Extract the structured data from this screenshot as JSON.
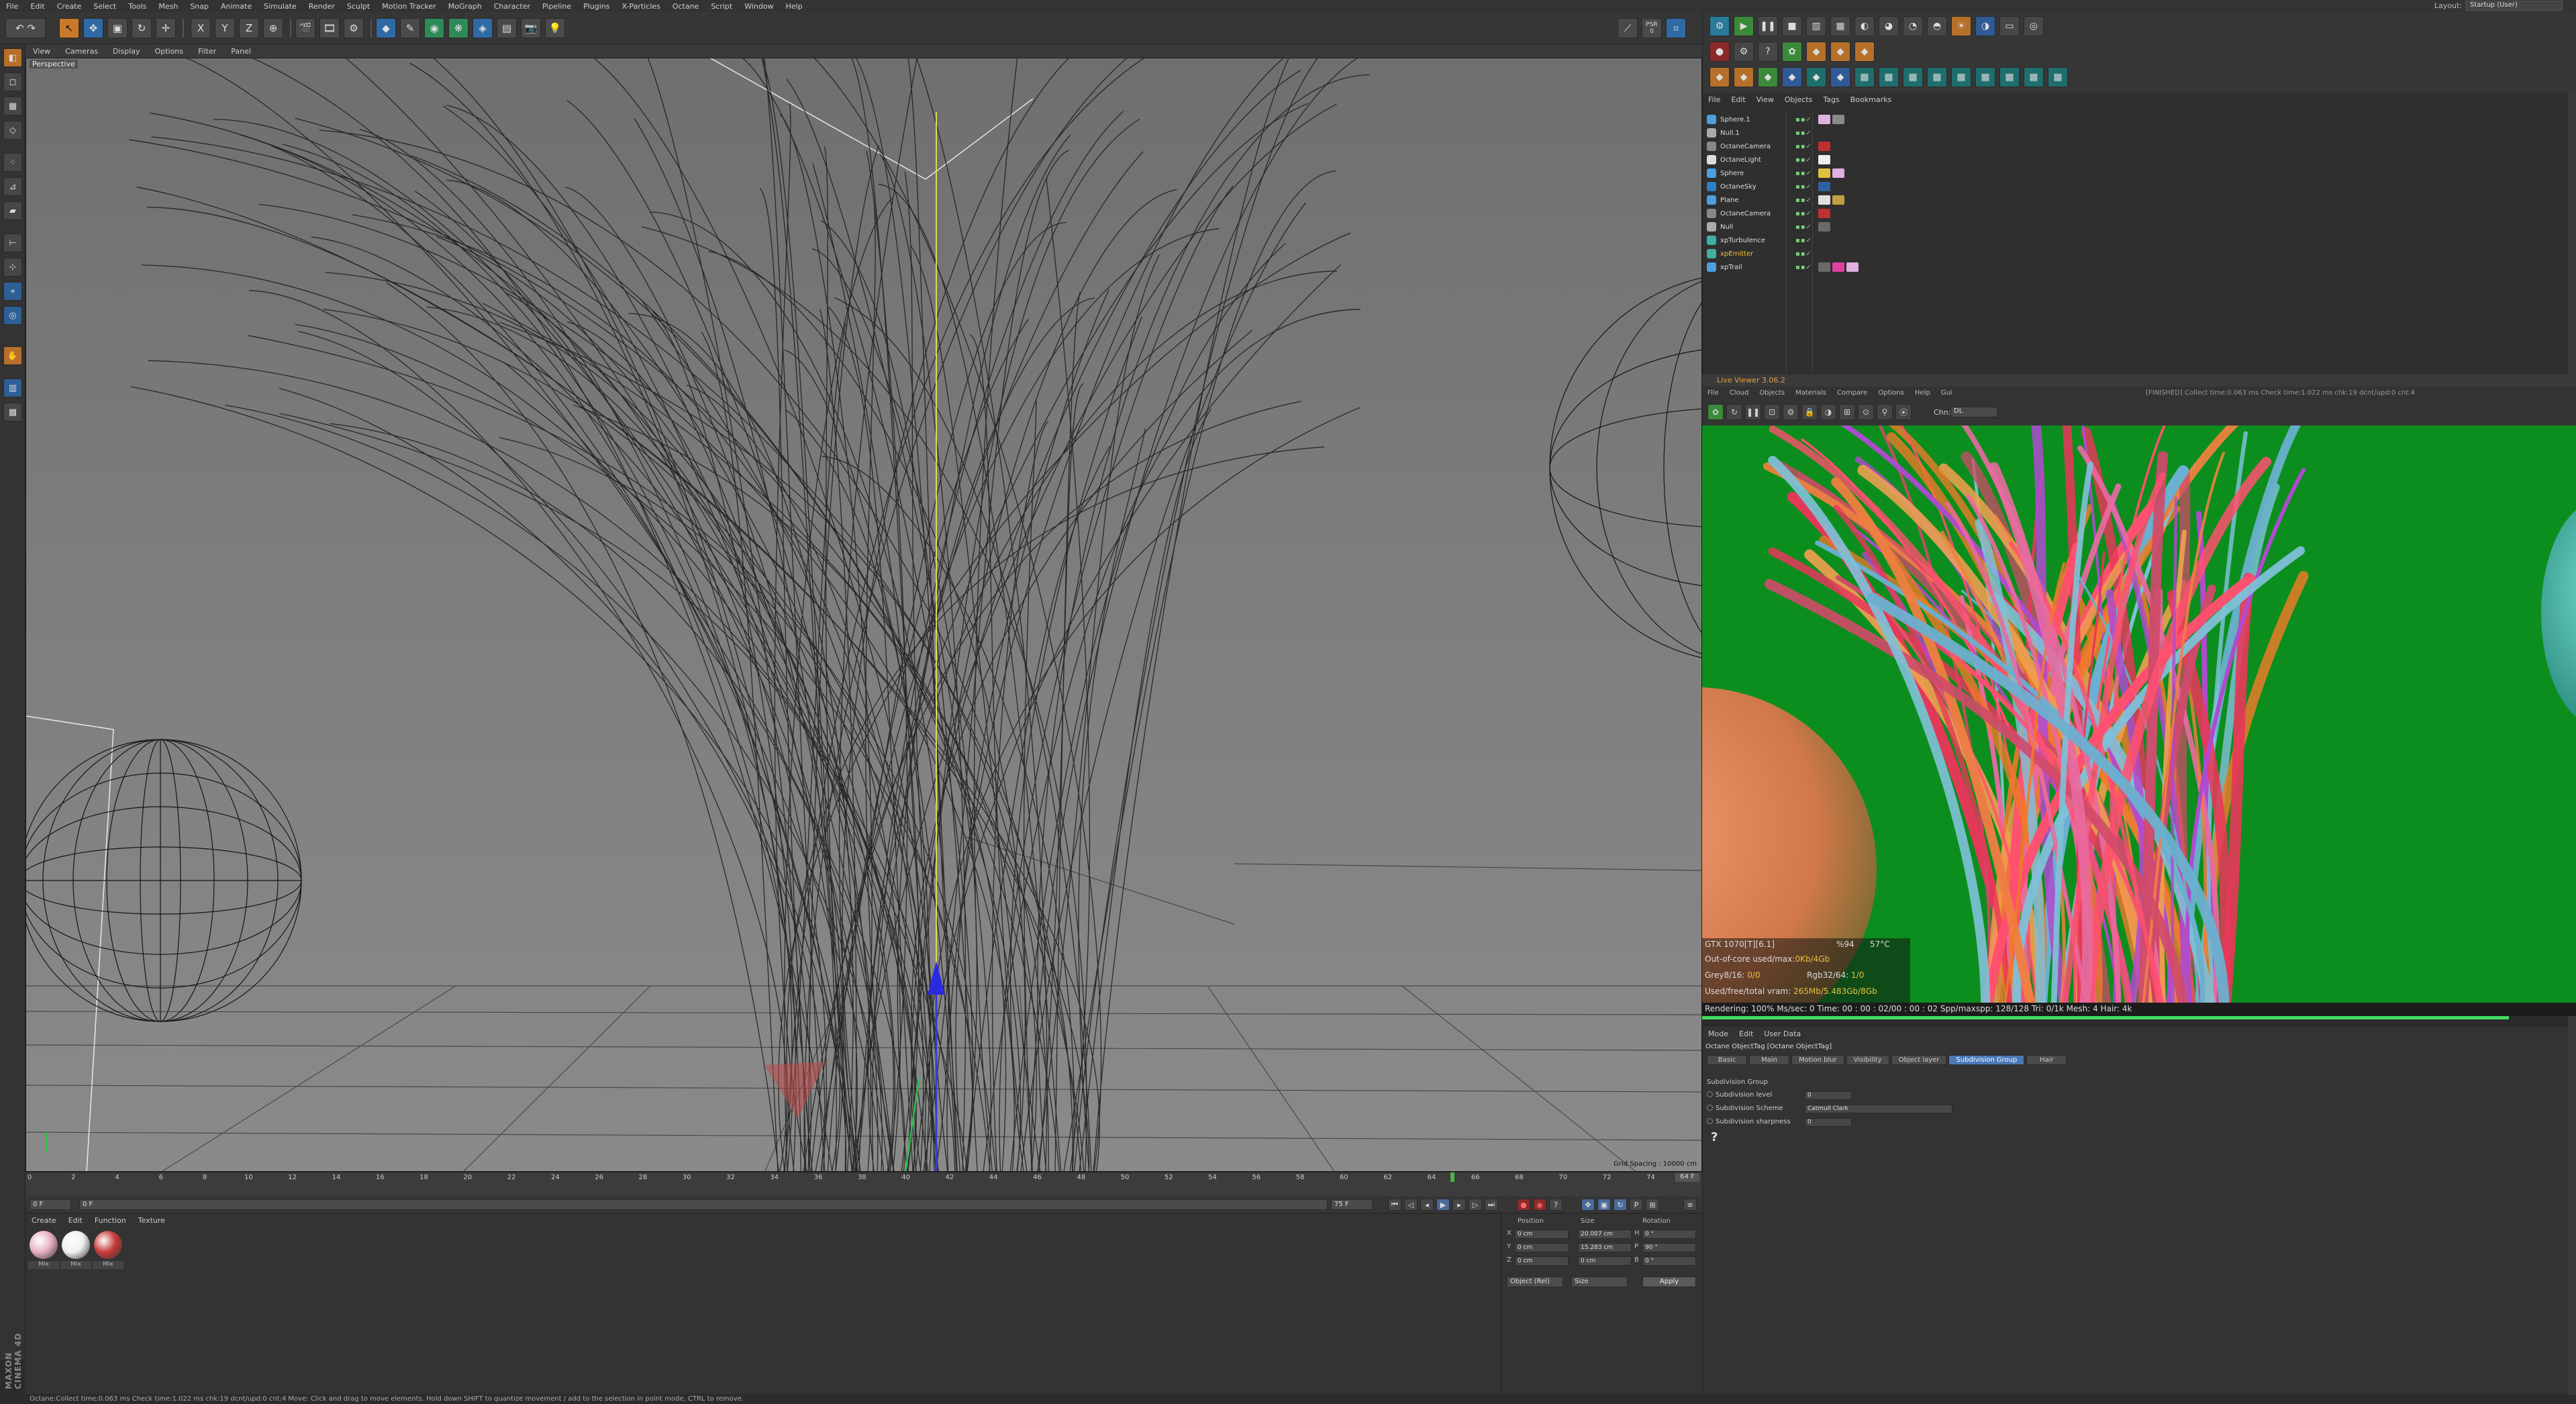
{
  "menubar": {
    "items": [
      "File",
      "Edit",
      "Create",
      "Select",
      "Tools",
      "Mesh",
      "Snap",
      "Animate",
      "Simulate",
      "Render",
      "Sculpt",
      "Motion Tracker",
      "MoGraph",
      "Character",
      "Pipeline",
      "Plugins",
      "X-Particles",
      "Octane",
      "Script",
      "Window",
      "Help"
    ],
    "layout_label": "Layout:",
    "layout_value": "Startup (User)"
  },
  "toolbar": {
    "psr_label": "PSR",
    "psr_value": "0",
    "axis_x": "X",
    "axis_y": "Y",
    "axis_z": "Z"
  },
  "viewport": {
    "menu": [
      "View",
      "Cameras",
      "Display",
      "Options",
      "Filter",
      "Panel"
    ],
    "label": "Perspective",
    "grid_spacing": "Grid Spacing : 10000 cm"
  },
  "timeline": {
    "ticks": [
      "0",
      "2",
      "4",
      "6",
      "8",
      "10",
      "12",
      "14",
      "16",
      "18",
      "20",
      "22",
      "24",
      "26",
      "28",
      "30",
      "32",
      "34",
      "36",
      "38",
      "40",
      "42",
      "44",
      "46",
      "48",
      "50",
      "52",
      "54",
      "56",
      "58",
      "60",
      "62",
      "64",
      "66",
      "68",
      "70",
      "72",
      "74"
    ],
    "current_frame": "64 F",
    "playhead_fraction": 0.8649,
    "start_field": "0 F",
    "min_field": "0 F",
    "max_field": "75 F",
    "end_field": "75 F"
  },
  "materials": {
    "menu": [
      "Create",
      "Edit",
      "Function",
      "Texture"
    ],
    "items": [
      {
        "label": "Mix",
        "color": "#e8b0c0"
      },
      {
        "label": "Mix",
        "color": "#f0f0f0"
      },
      {
        "label": "Mix",
        "color": "#c83a3a"
      }
    ]
  },
  "coords": {
    "headers": [
      "Position",
      "Size",
      "Rotation"
    ],
    "rows": [
      {
        "axis": "X",
        "pos": "0 cm",
        "size": "20.007 cm",
        "rot_axis": "H",
        "rot": "0 °"
      },
      {
        "axis": "Y",
        "pos": "0 cm",
        "size": "15.283 cm",
        "rot_axis": "P",
        "rot": "90 °"
      },
      {
        "axis": "Z",
        "pos": "0 cm",
        "size": "0 cm",
        "rot_axis": "B",
        "rot": "0 °"
      }
    ],
    "mode_dropdown": "Object (Rel)",
    "size_dropdown": "Size",
    "apply": "Apply"
  },
  "object_manager": {
    "menu": [
      "File",
      "Edit",
      "View",
      "Objects",
      "Tags",
      "Bookmarks"
    ],
    "objects": [
      {
        "name": "Sphere.1",
        "icon_color": "#4aa0e0",
        "highlight": false,
        "tags": [
          "#e0b0e0",
          "#8a8a8a"
        ]
      },
      {
        "name": "Null.1",
        "icon_color": "#aaaaaa",
        "highlight": false,
        "tags": []
      },
      {
        "name": "OctaneCamera",
        "icon_color": "#888888",
        "highlight": false,
        "tags": [
          "#c03030"
        ]
      },
      {
        "name": "OctaneLight",
        "icon_color": "#dddddd",
        "highlight": false,
        "tags": [
          "#eeeeee"
        ]
      },
      {
        "name": "Sphere",
        "icon_color": "#4aa0e0",
        "highlight": false,
        "tags": [
          "#e0c040",
          "#e0b0e0"
        ]
      },
      {
        "name": "OctaneSky",
        "icon_color": "#3080c0",
        "highlight": false,
        "tags": [
          "#3060a0"
        ]
      },
      {
        "name": "Plane",
        "icon_color": "#4aa0e0",
        "highlight": false,
        "tags": [
          "#e0e0e0",
          "#c0a040"
        ]
      },
      {
        "name": "OctaneCamera",
        "icon_color": "#888888",
        "highlight": false,
        "tags": [
          "#c03030"
        ]
      },
      {
        "name": "Null",
        "icon_color": "#aaaaaa",
        "highlight": false,
        "tags": [
          "#6a6a6a"
        ]
      },
      {
        "name": "xpTurbulence",
        "icon_color": "#40b0a0",
        "highlight": false,
        "tags": []
      },
      {
        "name": "xpEmitter",
        "icon_color": "#40b0a0",
        "highlight": true,
        "tags": []
      },
      {
        "name": "xpTrail",
        "icon_color": "#4aa0e0",
        "highlight": false,
        "tags": [
          "#6a6a6a",
          "#e040a0",
          "#e0b0e0"
        ]
      }
    ]
  },
  "live_viewer": {
    "title": "Live Viewer 3.06.2",
    "menu": [
      "File",
      "Cloud",
      "Objects",
      "Materials",
      "Compare",
      "Options",
      "Help",
      "Gui"
    ],
    "info": "[FINISHED] Collect time:0.063 ms  Check time:1.022 ms  chk:19  dcnt/upd:0  cnt:4",
    "channel_label": "Chn:",
    "channel_value": "DL"
  },
  "render_stats": {
    "gpu": "GTX 1070[T][6.1]",
    "gpu_pct": "%94",
    "gpu_temp": "57°C",
    "out_of_core_label": "Out-of-core used/max:",
    "out_of_core_value": "0Kb/4Gb",
    "grey_label": "Grey8/16:",
    "grey_value": "0/0",
    "rgb_label": "Rgb32/64:",
    "rgb_value": "1/0",
    "vram_label": "Used/free/total vram:",
    "vram_value": "265Mb/5.483Gb/8Gb",
    "progress_text": "Rendering: 100%  Ms/sec: 0    Time: 00 : 00 : 02/00 : 00 : 02    Spp/maxspp: 128/128    Tri: 0/1k  Mesh: 4   Hair: 4k",
    "progress_fraction": 1.0
  },
  "attributes": {
    "menu": [
      "Mode",
      "Edit",
      "User Data"
    ],
    "object_line": "Octane ObjectTag [Octane ObjectTag]",
    "tabs": [
      "Basic",
      "Main",
      "Motion blur",
      "Visibility",
      "Object layer",
      "Subdivision Group",
      "Hair"
    ],
    "active_tab": "Subdivision Group",
    "group_title": "Subdivision Group",
    "fields": [
      {
        "label": "Subdivision level",
        "value": "0"
      },
      {
        "label": "Subdivision Scheme",
        "value": "Catmull Clark"
      },
      {
        "label": "Subdivision sharpness",
        "value": "0"
      }
    ],
    "help_glyph": "?"
  },
  "statusbar": {
    "text": "Octane:Collect time:0.063 ms  Check time:1.022 ms  chk:19  dcnt/upd:0  cnt:4     Move: Click and drag to move elements. Hold down SHIFT to quantize movement / add to the selection in point mode, CTRL to remove."
  },
  "branding": {
    "logo_text": "MAXON CINEMA 4D"
  }
}
